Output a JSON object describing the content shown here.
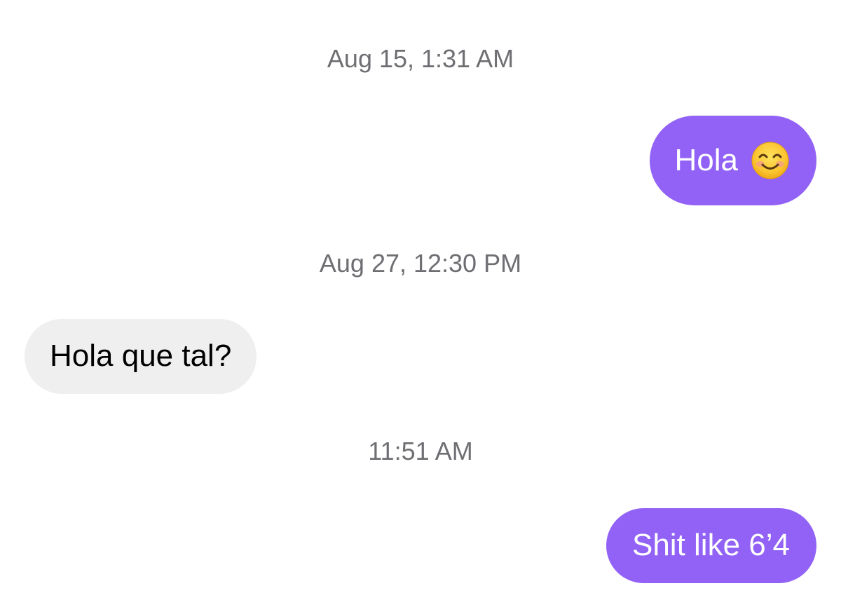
{
  "conversation": {
    "items": [
      {
        "type": "timestamp",
        "text": "Aug 15, 1:31 AM"
      },
      {
        "type": "message",
        "direction": "outgoing",
        "text": "Hola",
        "emoji": "smiling-face-with-smiling-eyes-icon"
      },
      {
        "type": "timestamp",
        "text": "Aug 27, 12:30 PM"
      },
      {
        "type": "message",
        "direction": "incoming",
        "text": "Hola que tal?"
      },
      {
        "type": "timestamp",
        "text": "11:51 AM"
      },
      {
        "type": "message",
        "direction": "outgoing",
        "text": "Shit like 6’4"
      }
    ]
  },
  "colors": {
    "outgoing_bubble": "#9162f5",
    "incoming_bubble": "#efefef",
    "timestamp_text": "#6e6e73"
  }
}
